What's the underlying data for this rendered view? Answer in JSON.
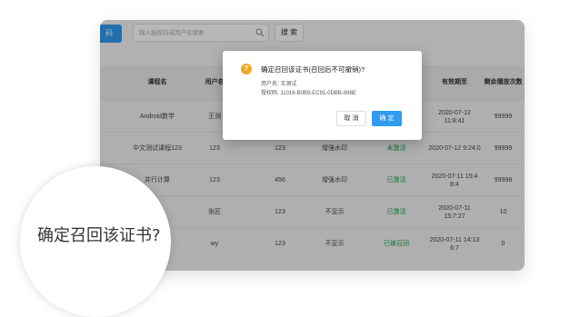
{
  "toolbar": {
    "tab_label": "码",
    "search_placeholder": "输入授权码或用户名搜索",
    "search_button": "搜 索"
  },
  "table": {
    "headers": [
      "课程名",
      "用户名",
      "",
      "",
      "",
      "有效期至",
      "剩余播放次数"
    ],
    "rows": [
      {
        "course": "Android数学",
        "user": "王测",
        "c3": "",
        "c4": "",
        "status": "",
        "expire": "2020-07-12 11:8:41",
        "remaining": "99999"
      },
      {
        "course": "中文测试课程123",
        "user": "123",
        "c3": "123",
        "c4": "增强水印",
        "status": "未激活",
        "expire": "2020-07-12 9:24:0",
        "remaining": "99999"
      },
      {
        "course": "并行计算",
        "user": "123",
        "c3": "456",
        "c4": "增强水印",
        "status": "已激活",
        "expire": "2020-07-11 15:4 8:4",
        "remaining": "99998"
      },
      {
        "course": "",
        "user": "张匠",
        "c3": "123",
        "c4": "不显示",
        "status": "已激活",
        "expire": "2020-07-11 15:7:27",
        "remaining": "10"
      },
      {
        "course": "",
        "user": "wy",
        "c3": "123",
        "c4": "不显示",
        "status": "已被召回",
        "expire": "2020-07-11 14:13 6:7",
        "remaining": "0"
      }
    ]
  },
  "dialog": {
    "title": "确定召回该证书(召回后不可撤销)?",
    "user_line": "用户名: 王测试",
    "code_line": "授权码: 11016-B0B9-EC91-0DBB-898E",
    "cancel_label": "取 消",
    "ok_label": "确 定",
    "warn_symbol": "?"
  },
  "magnifier": {
    "text": "确定召回该证书?"
  }
}
